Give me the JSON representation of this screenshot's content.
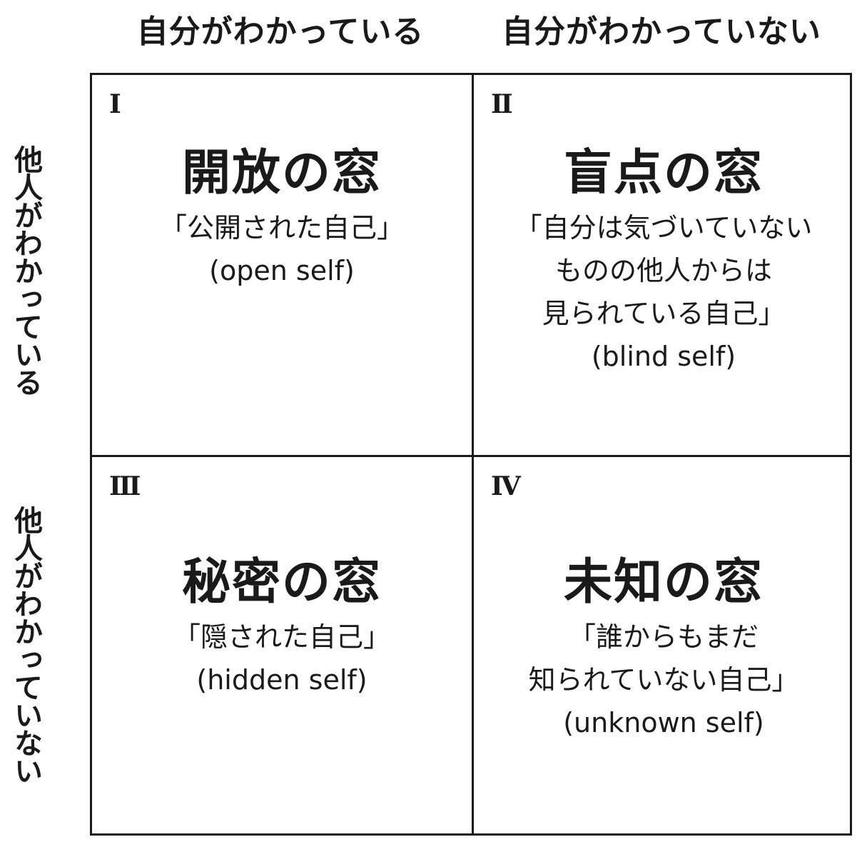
{
  "column_headers": [
    "自分がわかっている",
    "自分がわかっていない"
  ],
  "row_headers": [
    "他人がわかっている",
    "他人がわかっていない"
  ],
  "quadrants": [
    {
      "numeral": "I",
      "title": "開放の窓",
      "desc1": "「公開された自己」",
      "desc2": "",
      "desc3": "",
      "en": "(open self)"
    },
    {
      "numeral": "II",
      "title": "盲点の窓",
      "desc1": "「自分は気づいていない",
      "desc2": "ものの他人からは",
      "desc3": "見られている自己」",
      "en": "(blind self)"
    },
    {
      "numeral": "III",
      "title": "秘密の窓",
      "desc1": "「隠された自己」",
      "desc2": "",
      "desc3": "",
      "en": "(hidden self)"
    },
    {
      "numeral": "IV",
      "title": "未知の窓",
      "desc1": "「誰からもまだ",
      "desc2": "知られていない自己」",
      "desc3": "",
      "en": "(unknown self)"
    }
  ],
  "colors": {
    "line": "#1a1a1a",
    "text": "#1a1a1a",
    "background": "#ffffff"
  }
}
